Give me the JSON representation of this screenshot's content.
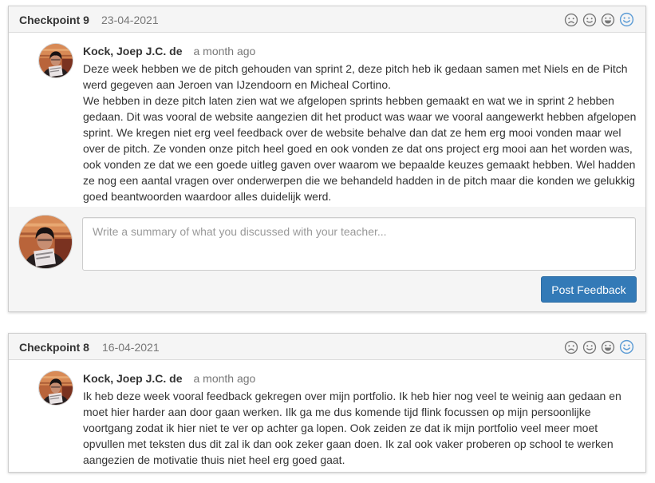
{
  "checkpoints": [
    {
      "title": "Checkpoint 9",
      "date": "23-04-2021",
      "moods": [
        "sad-face-icon",
        "neutral-face-icon",
        "happy-face-icon",
        "very-happy-face-icon"
      ],
      "selected_mood": "very-happy-face-icon",
      "entry": {
        "author": "Kock, Joep J.C. de",
        "time": "a month ago",
        "paragraphs": [
          "Deze week hebben we de pitch gehouden van sprint 2, deze pitch heb ik gedaan samen met Niels en de Pitch werd gegeven aan Jeroen van IJzendoorn en Micheal Cortino.",
          "We hebben in deze pitch laten zien wat we afgelopen sprints hebben gemaakt en wat we in sprint 2 hebben gedaan. Dit was vooral de website aangezien dit het product was waar we vooral aangewerkt hebben afgelopen sprint. We kregen niet erg veel feedback over de website behalve dan dat ze hem erg mooi vonden maar wel over de pitch. Ze vonden onze pitch heel goed en ook vonden ze dat ons project erg mooi aan het worden was, ook vonden ze dat we een goede uitleg gaven over waarom we bepaalde keuzes gemaakt hebben. Wel hadden ze nog een aantal vragen over onderwerpen die we behandeld hadden in de pitch maar die konden we gelukkig goed beantwoorden waardoor alles duidelijk werd."
        ]
      },
      "reply": {
        "placeholder": "Write a summary of what you discussed with your teacher...",
        "button_label": "Post Feedback"
      }
    },
    {
      "title": "Checkpoint 8",
      "date": "16-04-2021",
      "moods": [
        "sad-face-icon",
        "neutral-face-icon",
        "happy-face-icon",
        "very-happy-face-icon"
      ],
      "selected_mood": "very-happy-face-icon",
      "entry": {
        "author": "Kock, Joep J.C. de",
        "time": "a month ago",
        "paragraphs": [
          "Ik heb deze week vooral feedback gekregen over mijn portfolio. Ik heb hier nog veel te weinig aan gedaan en moet hier harder aan door gaan werken. Ilk ga me dus komende tijd flink focussen op mijn persoonlijke voortgang zodat ik hier niet te ver op achter ga lopen. Ook zeiden ze dat ik mijn portfolio veel meer moet opvullen met teksten dus dit zal ik dan ook zeker gaan doen. Ik zal ook vaker proberen op school te werken aangezien de motivatie thuis niet heel erg goed gaat."
        ]
      }
    }
  ],
  "colors": {
    "mood_default": "#777777",
    "mood_selected": "#5b9bd5",
    "primary_button": "#337ab7"
  }
}
